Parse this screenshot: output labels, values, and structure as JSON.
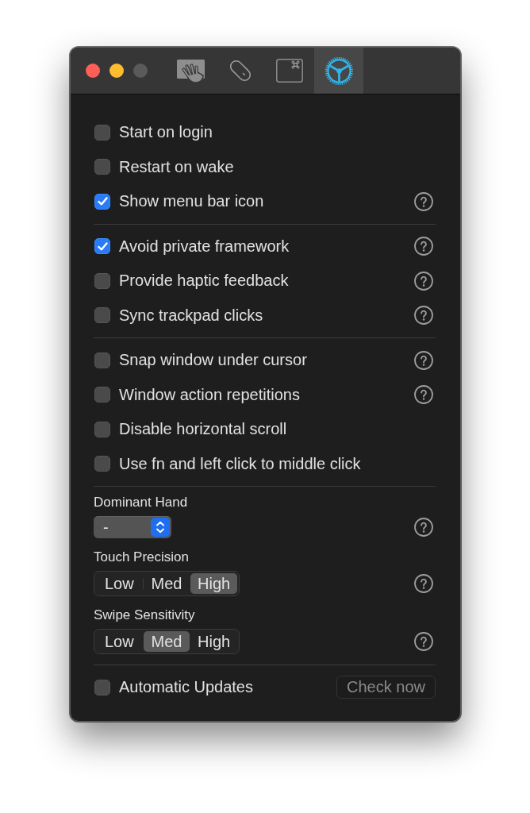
{
  "window": {
    "buttons": [
      {
        "kind": "close",
        "disabled": false
      },
      {
        "kind": "minimize",
        "disabled": false
      },
      {
        "kind": "zoom",
        "disabled": true
      }
    ]
  },
  "toolbar": {
    "tabs": [
      {
        "kind": "trackpad",
        "selected": false
      },
      {
        "kind": "mouse",
        "selected": false
      },
      {
        "kind": "keyboard",
        "selected": false
      },
      {
        "kind": "settings",
        "selected": true
      }
    ]
  },
  "sections": [
    {
      "items": [
        {
          "kind": "checkbox",
          "label": "Start on login",
          "checked": false,
          "help": false
        },
        {
          "kind": "checkbox",
          "label": "Restart on wake",
          "checked": false,
          "help": false
        },
        {
          "kind": "checkbox",
          "label": "Show menu bar icon",
          "checked": true,
          "help": true
        }
      ]
    },
    {
      "items": [
        {
          "kind": "checkbox",
          "label": "Avoid private framework",
          "checked": true,
          "help": true
        },
        {
          "kind": "checkbox",
          "label": "Provide haptic feedback",
          "checked": false,
          "help": true
        },
        {
          "kind": "checkbox",
          "label": "Sync trackpad clicks",
          "checked": false,
          "help": true
        }
      ]
    },
    {
      "items": [
        {
          "kind": "checkbox",
          "label": "Snap window under cursor",
          "checked": false,
          "help": true
        },
        {
          "kind": "checkbox",
          "label": "Window action repetitions",
          "checked": false,
          "help": true
        },
        {
          "kind": "checkbox",
          "label": "Disable horizontal scroll",
          "checked": false,
          "help": false
        },
        {
          "kind": "checkbox",
          "label": "Use fn and left click to middle click",
          "checked": false,
          "help": false
        }
      ]
    },
    {
      "items": [
        {
          "kind": "popup",
          "label": "Dominant Hand",
          "value": "-",
          "help": true
        },
        {
          "kind": "segmented",
          "label": "Touch Precision",
          "options": [
            {
              "label": "Low",
              "selected": false
            },
            {
              "label": "Med",
              "selected": false
            },
            {
              "label": "High",
              "selected": true
            }
          ],
          "help": true
        },
        {
          "kind": "segmented",
          "label": "Swipe Sensitivity",
          "options": [
            {
              "label": "Low",
              "selected": false
            },
            {
              "label": "Med",
              "selected": true
            },
            {
              "label": "High",
              "selected": false
            }
          ],
          "help": true
        }
      ]
    },
    {
      "items": [
        {
          "kind": "checkbox",
          "label": "Automatic Updates",
          "checked": false,
          "help": false,
          "button": {
            "label": "Check now",
            "disabled": true
          }
        }
      ]
    }
  ]
}
